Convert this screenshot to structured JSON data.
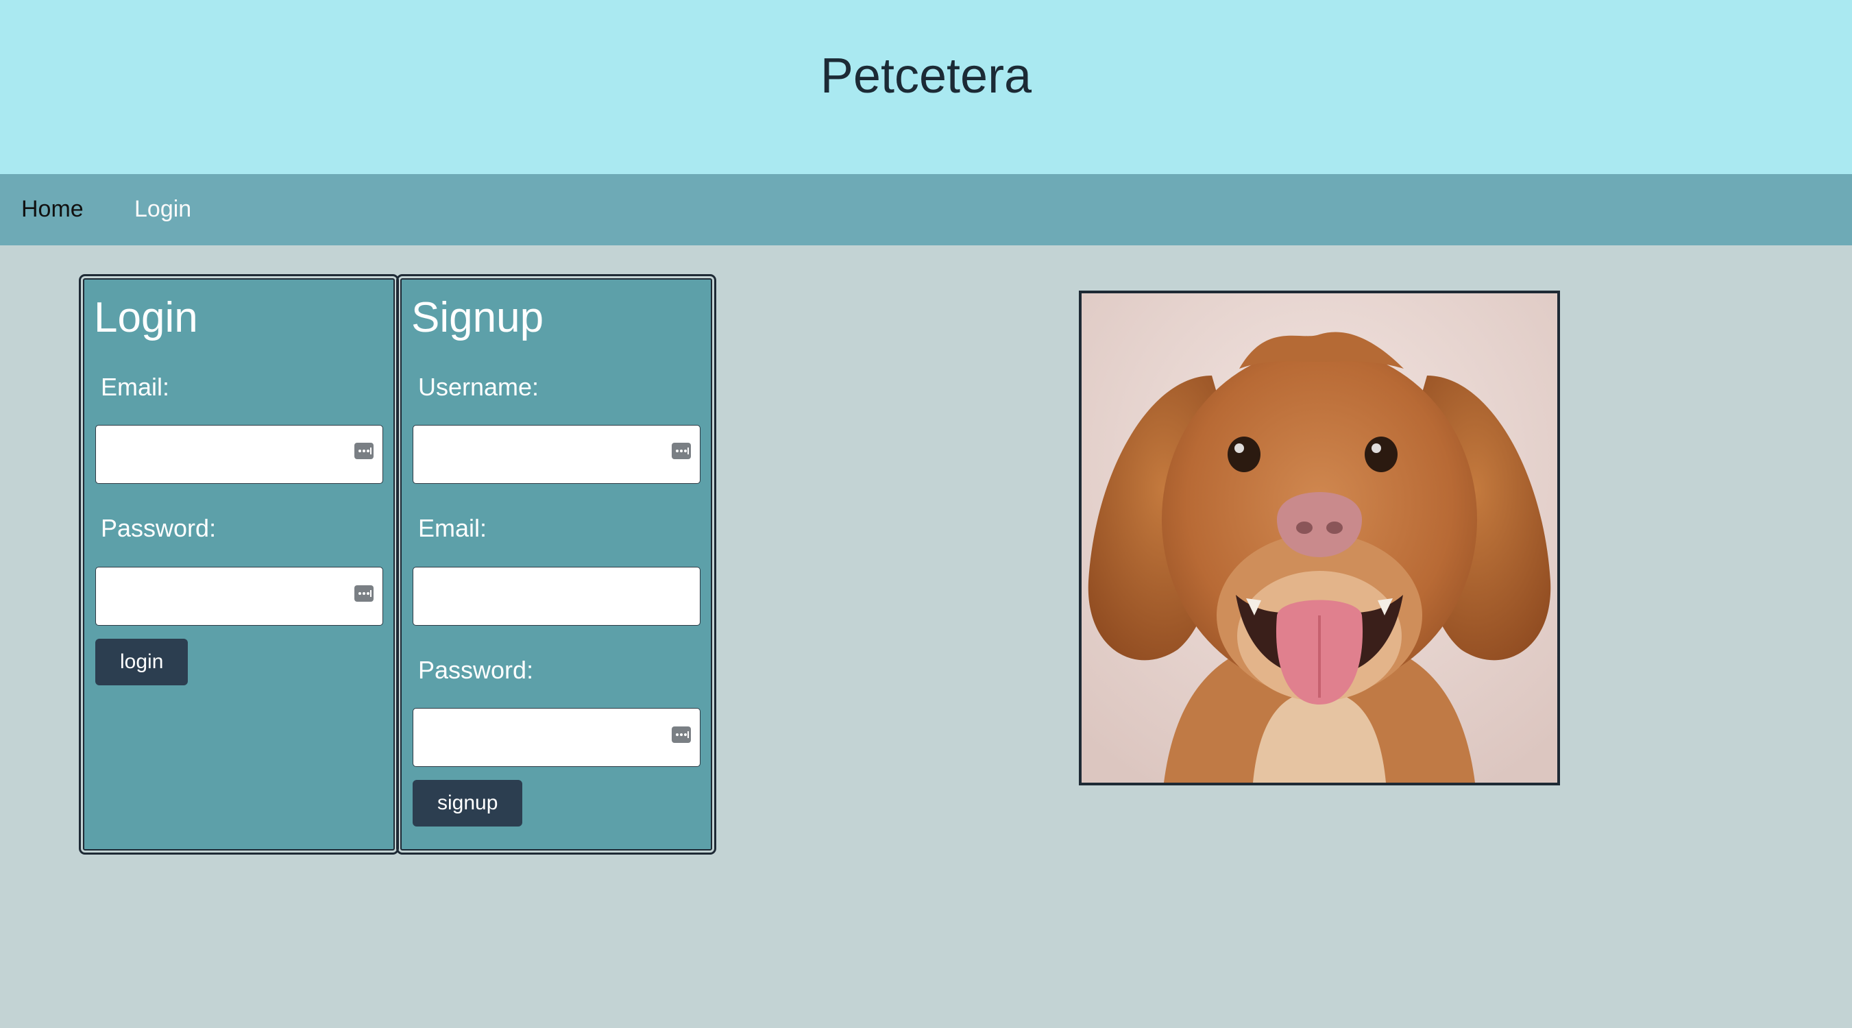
{
  "header": {
    "title": "Petcetera"
  },
  "nav": {
    "home_label": "Home",
    "login_label": "Login"
  },
  "login": {
    "title": "Login",
    "email_label": "Email:",
    "email_value": "",
    "password_label": "Password:",
    "password_value": "",
    "button_label": "login"
  },
  "signup": {
    "title": "Signup",
    "username_label": "Username:",
    "username_value": "",
    "email_label": "Email:",
    "email_value": "",
    "password_label": "Password:",
    "password_value": "",
    "button_label": "signup"
  },
  "hero_image": {
    "subject": "dog-photo"
  },
  "colors": {
    "header_bg": "#aae9f1",
    "nav_bg": "#6eaab6",
    "page_bg": "#c3d3d4",
    "panel_bg": "#5da0a9",
    "button_bg": "#2c3e50"
  }
}
